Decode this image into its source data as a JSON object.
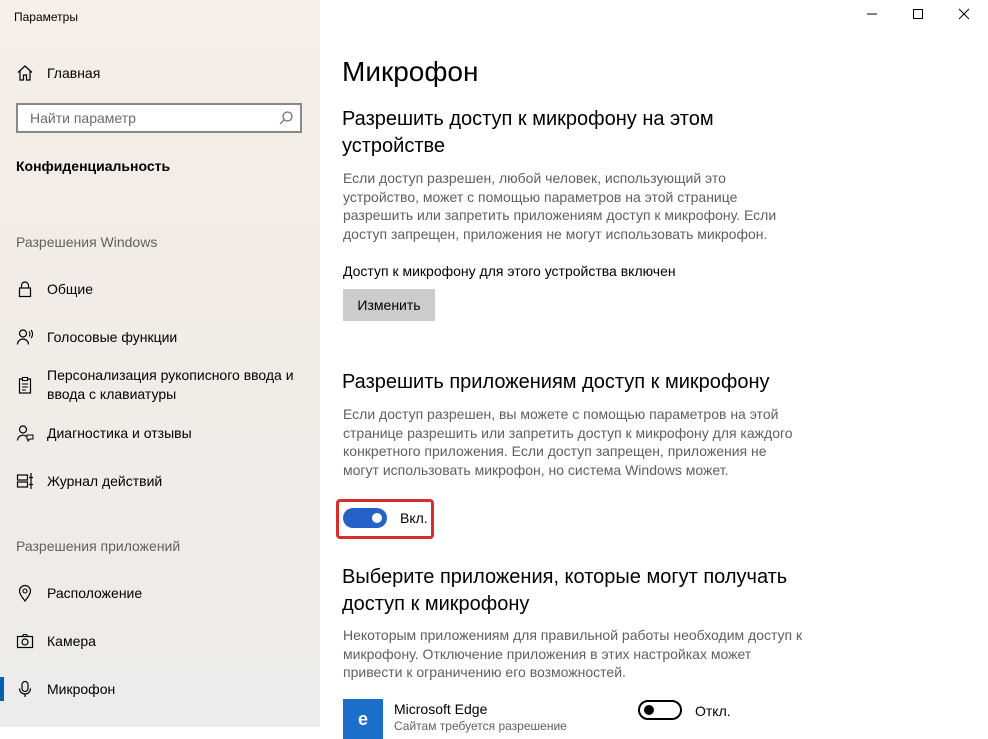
{
  "window": {
    "title": "Параметры",
    "controls": [
      "minimize",
      "maximize",
      "close"
    ]
  },
  "sidebar": {
    "home_label": "Главная",
    "search_placeholder": "Найти параметр",
    "category": "Конфиденциальность",
    "section_windows": "Разрешения Windows",
    "windows_items": [
      {
        "label": "Общие",
        "icon": "lock-icon"
      },
      {
        "label": "Голосовые функции",
        "icon": "speech-icon"
      },
      {
        "label": "Персонализация рукописного ввода и ввода с клавиатуры",
        "icon": "clipboard-icon"
      },
      {
        "label": "Диагностика и отзывы",
        "icon": "feedback-icon"
      },
      {
        "label": "Журнал действий",
        "icon": "timeline-icon"
      }
    ],
    "section_apps": "Разрешения приложений",
    "apps_items": [
      {
        "label": "Расположение",
        "icon": "location-icon"
      },
      {
        "label": "Камера",
        "icon": "camera-icon"
      },
      {
        "label": "Микрофон",
        "icon": "microphone-icon",
        "active": true
      }
    ],
    "accent_color": "#0063b1"
  },
  "main": {
    "title": "Микрофон",
    "device_section": {
      "heading": "Разрешить доступ к микрофону на этом устройстве",
      "description": "Если доступ разрешен, любой человек, использующий это устройство, может с помощью параметров на этой странице разрешить или запретить приложениям доступ к микрофону. Если доступ запрещен, приложения не могут использовать микрофон.",
      "status": "Доступ к микрофону для этого устройства включен",
      "change_button": "Изменить"
    },
    "apps_access_section": {
      "heading": "Разрешить приложениям доступ к микрофону",
      "description": "Если доступ разрешен, вы можете с помощью параметров на этой странице разрешить или запретить доступ к микрофону для каждого конкретного приложения. Если доступ запрещен, приложения не могут использовать микрофон, но система Windows может.",
      "toggle_state": "on",
      "toggle_label": "Вкл.",
      "highlight_color": "#d72d2d"
    },
    "choose_apps_section": {
      "heading": "Выберите приложения, которые могут получать доступ к микрофону",
      "description": "Некоторым приложениям для правильной работы необходим доступ к микрофону. Отключение приложения в этих настройках может привести к ограничению его возможностей.",
      "apps": [
        {
          "name": "Microsoft Edge",
          "subtitle": "Сайтам требуется разрешение",
          "toggle_state": "off",
          "toggle_label": "Откл.",
          "icon": "edge-icon"
        }
      ]
    },
    "toggle_on_color": "#2661c9"
  }
}
